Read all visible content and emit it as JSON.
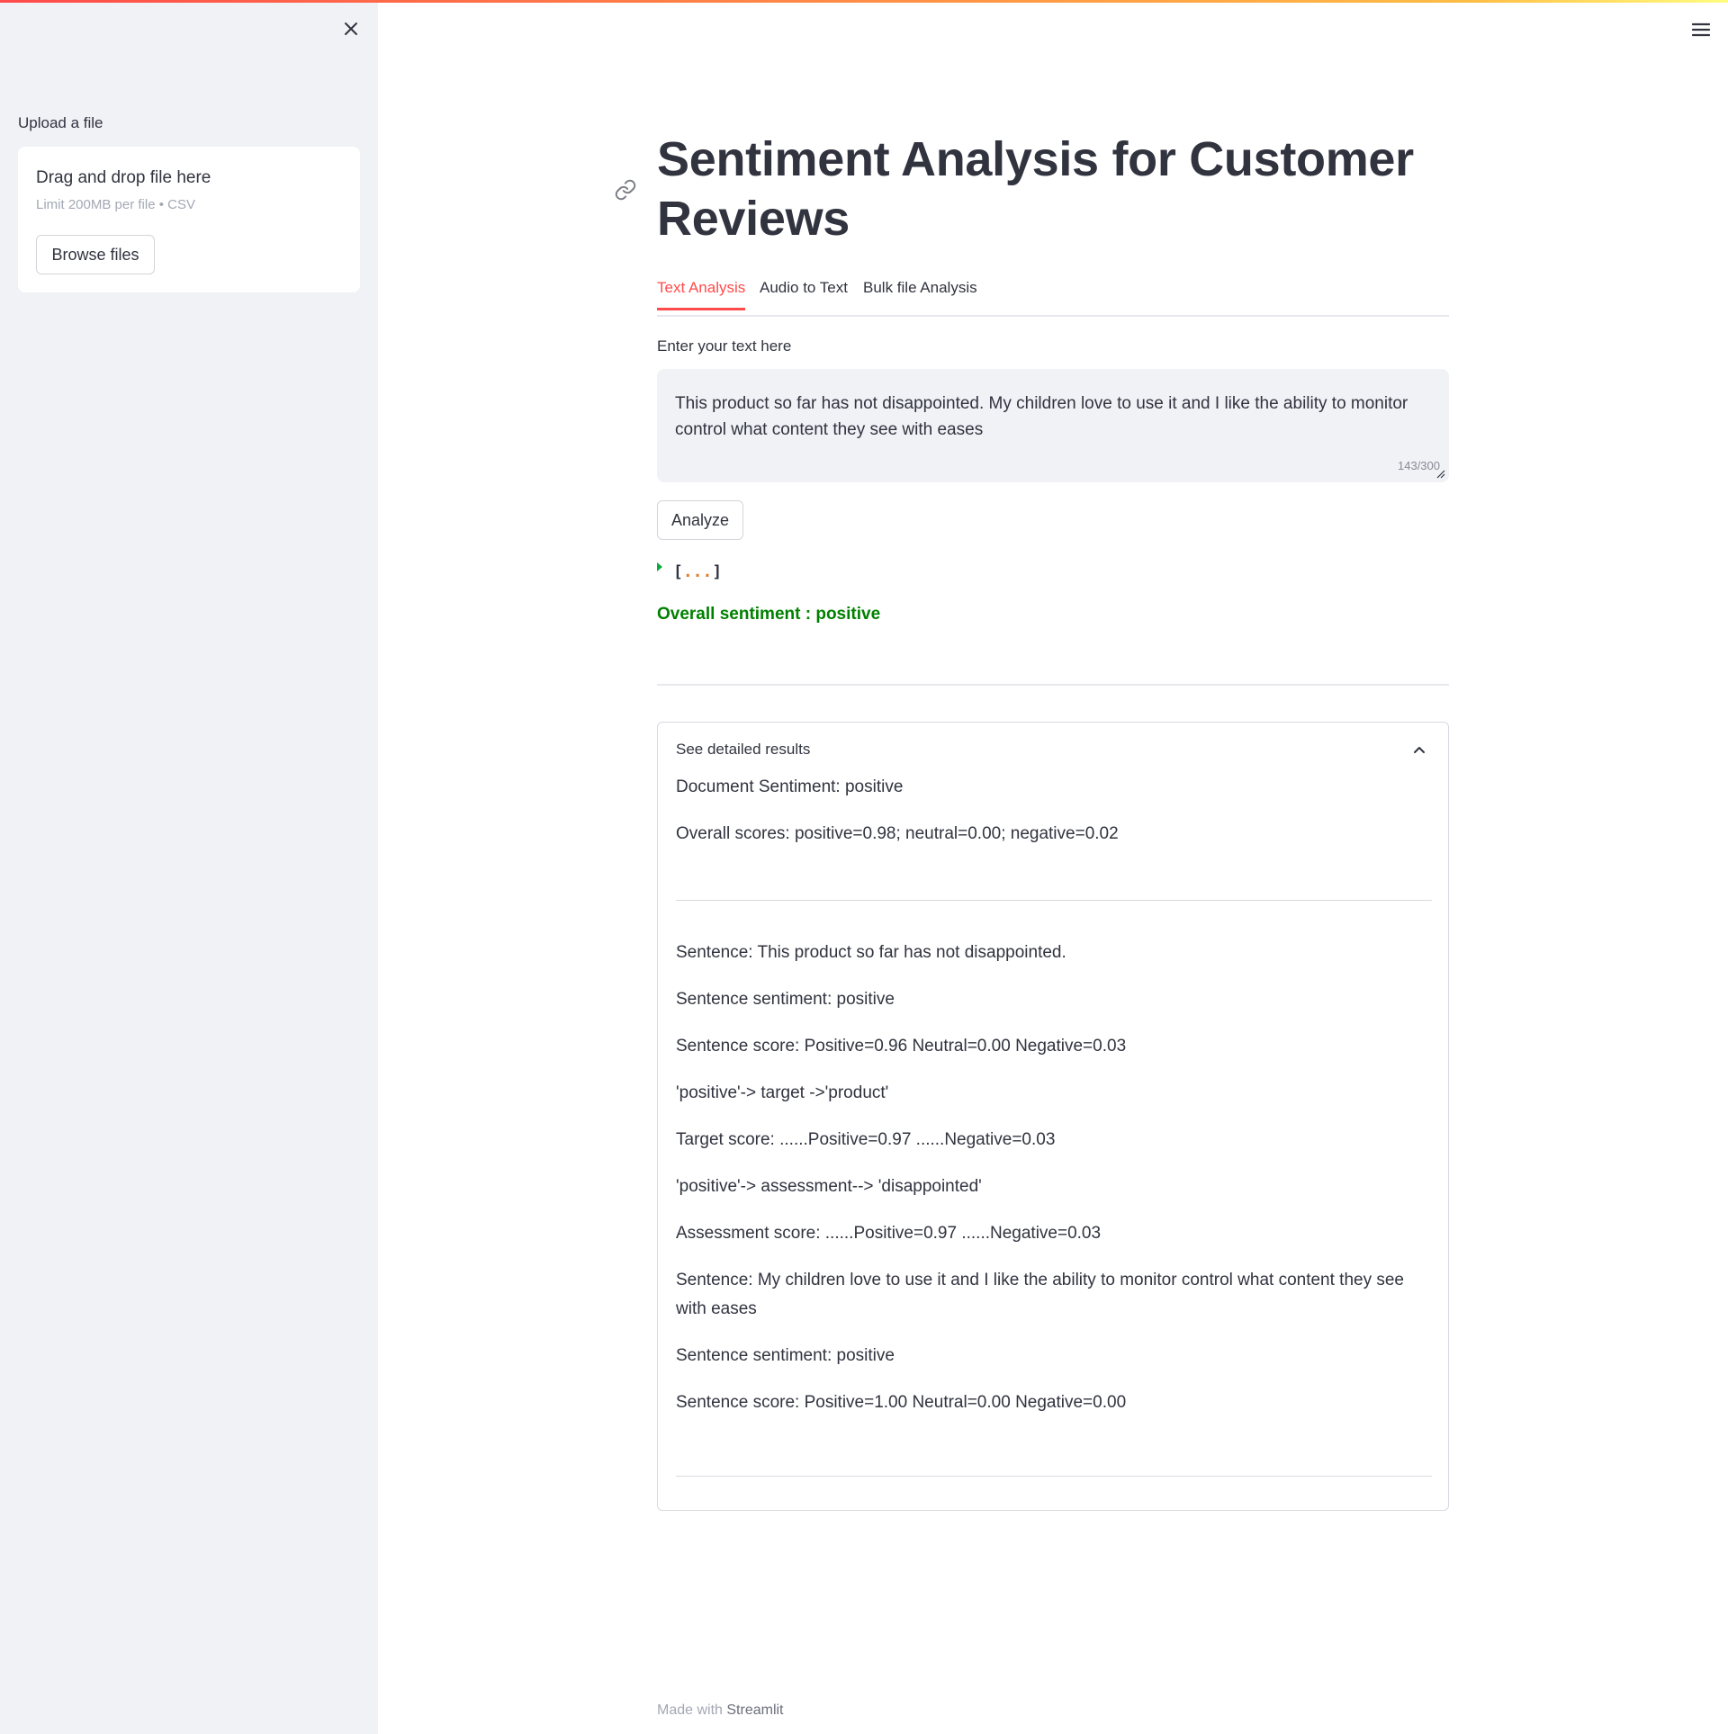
{
  "sidebar": {
    "upload_label": "Upload a file",
    "dropzone": {
      "title": "Drag and drop file here",
      "subtitle": "Limit 200MB per file • CSV",
      "browse_label": "Browse files"
    }
  },
  "main": {
    "title": "Sentiment Analysis for Customer Reviews",
    "tabs": [
      {
        "label": "Text Analysis",
        "active": true
      },
      {
        "label": "Audio to Text",
        "active": false
      },
      {
        "label": "Bulk file Analysis",
        "active": false
      }
    ],
    "input": {
      "label": "Enter your text here",
      "value": "This product so far has not disappointed. My children love to use it and I like the ability to monitor control what content they see with eases",
      "counter": "143/300"
    },
    "analyze_label": "Analyze",
    "json_preview": {
      "open": "[",
      "dots": "...",
      "close": "]"
    },
    "overall_sentiment": "Overall sentiment : positive",
    "expander": {
      "header": "See detailed results",
      "document_sentiment": "Document Sentiment: positive",
      "overall_scores": "Overall scores: positive=0.98; neutral=0.00; negative=0.02",
      "sentences": [
        {
          "sentence": "Sentence: This product so far has not disappointed.",
          "sentiment": "Sentence sentiment: positive",
          "score": "Sentence score: Positive=0.96 Neutral=0.00 Negative=0.03",
          "target": "'positive'-> target ->'product'",
          "target_score": "Target score: ......Positive=0.97 ......Negative=0.03",
          "assessment": "'positive'-> assessment--> 'disappointed'",
          "assessment_score": "Assessment score: ......Positive=0.97 ......Negative=0.03"
        },
        {
          "sentence": "Sentence: My children love to use it and I like the ability to monitor control what content they see with eases",
          "sentiment": "Sentence sentiment: positive",
          "score": "Sentence score: Positive=1.00 Neutral=0.00 Negative=0.00"
        }
      ]
    }
  },
  "footer": {
    "prefix": "Made with",
    "link": "Streamlit"
  },
  "colors": {
    "accent": "#ff4b4b",
    "sidebar_bg": "#f0f2f6",
    "positive_text": "#008000",
    "text": "#31333f"
  },
  "icons": {
    "close": "close-icon",
    "menu": "hamburger-menu-icon",
    "anchor": "link-icon",
    "collapse": "chevron-up-icon",
    "json_toggle": "caret-right-icon"
  }
}
